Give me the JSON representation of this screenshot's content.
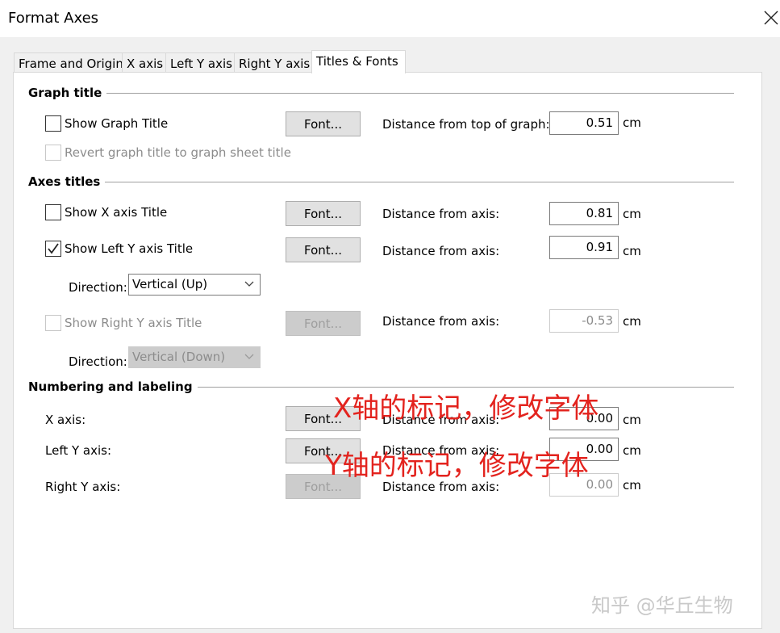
{
  "window": {
    "title": "Format Axes"
  },
  "tabs": [
    {
      "label": "Frame and Origin",
      "active": false
    },
    {
      "label": "X axis",
      "active": false
    },
    {
      "label": "Left Y axis",
      "active": false
    },
    {
      "label": "Right Y axis",
      "active": false
    },
    {
      "label": "Titles & Fonts",
      "active": true
    }
  ],
  "graph_title": {
    "heading": "Graph title",
    "show_graph_title": {
      "label": "Show Graph Title",
      "checked": false
    },
    "revert_title": {
      "label": "Revert graph title to graph sheet title",
      "checked": false,
      "disabled": true
    },
    "font_button": "Font...",
    "distance_label": "Distance from top of graph:",
    "distance_value": "0.51",
    "unit": "cm"
  },
  "axes_titles": {
    "heading": "Axes titles",
    "x_title": {
      "label": "Show X axis Title",
      "checked": false,
      "font_button": "Font...",
      "distance_label": "Distance from axis:",
      "distance_value": "0.81",
      "unit": "cm"
    },
    "left_y_title": {
      "label": "Show Left Y axis Title",
      "checked": true,
      "font_button": "Font...",
      "distance_label": "Distance from axis:",
      "distance_value": "0.91",
      "unit": "cm",
      "direction_label": "Direction:",
      "direction_value": "Vertical (Up)"
    },
    "right_y_title": {
      "label": "Show Right Y axis Title",
      "checked": false,
      "disabled": true,
      "font_button": "Font...",
      "distance_label": "Distance from axis:",
      "distance_value": "-0.53",
      "unit": "cm",
      "direction_label": "Direction:",
      "direction_value": "Vertical (Down)"
    }
  },
  "numbering": {
    "heading": "Numbering and labeling",
    "x_axis": {
      "label": "X axis:",
      "font_button": "Font...",
      "distance_label": "Distance from axis:",
      "distance_value": "0.00",
      "unit": "cm"
    },
    "left_y_axis": {
      "label": "Left Y axis:",
      "font_button": "Font...",
      "distance_label": "Distance from axis:",
      "distance_value": "0.00",
      "unit": "cm"
    },
    "right_y_axis": {
      "label": "Right Y axis:",
      "font_button": "Font...",
      "distance_label": "Distance from axis:",
      "distance_value": "0.00",
      "unit": "cm",
      "disabled": true
    }
  },
  "annotations": {
    "x_note": "X轴的标记，修改字体",
    "y_note": "Y轴的标记，修改字体",
    "color": "#e3231e"
  },
  "watermark": "知乎 @华丘生物"
}
